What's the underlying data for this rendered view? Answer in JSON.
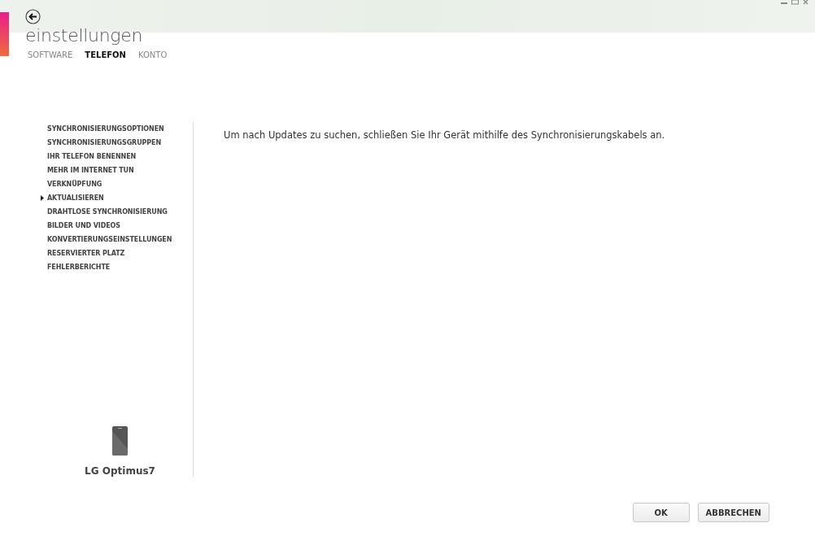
{
  "header": {
    "title": "einstellungen"
  },
  "tabs": [
    {
      "label": "SOFTWARE",
      "selected": false
    },
    {
      "label": "TELEFON",
      "selected": true
    },
    {
      "label": "KONTO",
      "selected": false
    }
  ],
  "sidebar": {
    "items": [
      {
        "label": "SYNCHRONISIERUNGSOPTIONEN",
        "selected": false
      },
      {
        "label": "SYNCHRONISIERUNGSGRUPPEN",
        "selected": false
      },
      {
        "label": "IHR TELEFON BENENNEN",
        "selected": false
      },
      {
        "label": "MEHR IM INTERNET TUN",
        "selected": false
      },
      {
        "label": "VERKNÜPFUNG",
        "selected": false
      },
      {
        "label": "AKTUALISIEREN",
        "selected": true
      },
      {
        "label": "DRAHTLOSE SYNCHRONISIERUNG",
        "selected": false
      },
      {
        "label": "BILDER UND VIDEOS",
        "selected": false
      },
      {
        "label": "KONVERTIERUNGSEINSTELLUNGEN",
        "selected": false
      },
      {
        "label": "RESERVIERTER PLATZ",
        "selected": false
      },
      {
        "label": "FEHLERBERICHTE",
        "selected": false
      }
    ],
    "device_name": "LG Optimus7"
  },
  "content": {
    "message": "Um nach Updates zu suchen, schließen Sie Ihr Gerät mithilfe des Synchronisierungskabels an."
  },
  "buttons": [
    "OK",
    "ABBRECHEN"
  ]
}
